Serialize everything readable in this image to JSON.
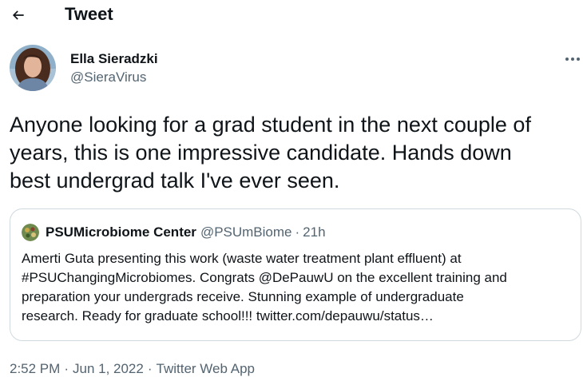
{
  "header": {
    "title": "Tweet",
    "back_icon": "arrow-left-icon"
  },
  "author": {
    "name": "Ella Sieradzki",
    "handle": "@SieraVirus"
  },
  "tweet": {
    "lines": [
      "Anyone looking for a grad student in the next couple of",
      "years, this is one impressive candidate. Hands down",
      "best undergrad talk I've ever seen."
    ]
  },
  "quote": {
    "name": "PSUMicrobiome Center",
    "handle": "@PSUmBiome",
    "separator": "·",
    "time": "21h",
    "lines": [
      "Amerti Guta presenting this work (waste water treatment plant effluent) at",
      "#PSUChangingMicrobiomes. Congrats @DePauwU on the excellent training and",
      "preparation your undergrads receive. Stunning example of undergraduate",
      "research. Ready for graduate school!!! twitter.com/depauwu/status…"
    ]
  },
  "meta": {
    "time": "2:52 PM",
    "separator": "·",
    "date": "Jun 1, 2022",
    "app": "Twitter Web App"
  },
  "colors": {
    "text": "#0f1419",
    "secondary": "#536471",
    "border": "#cfd9de"
  }
}
